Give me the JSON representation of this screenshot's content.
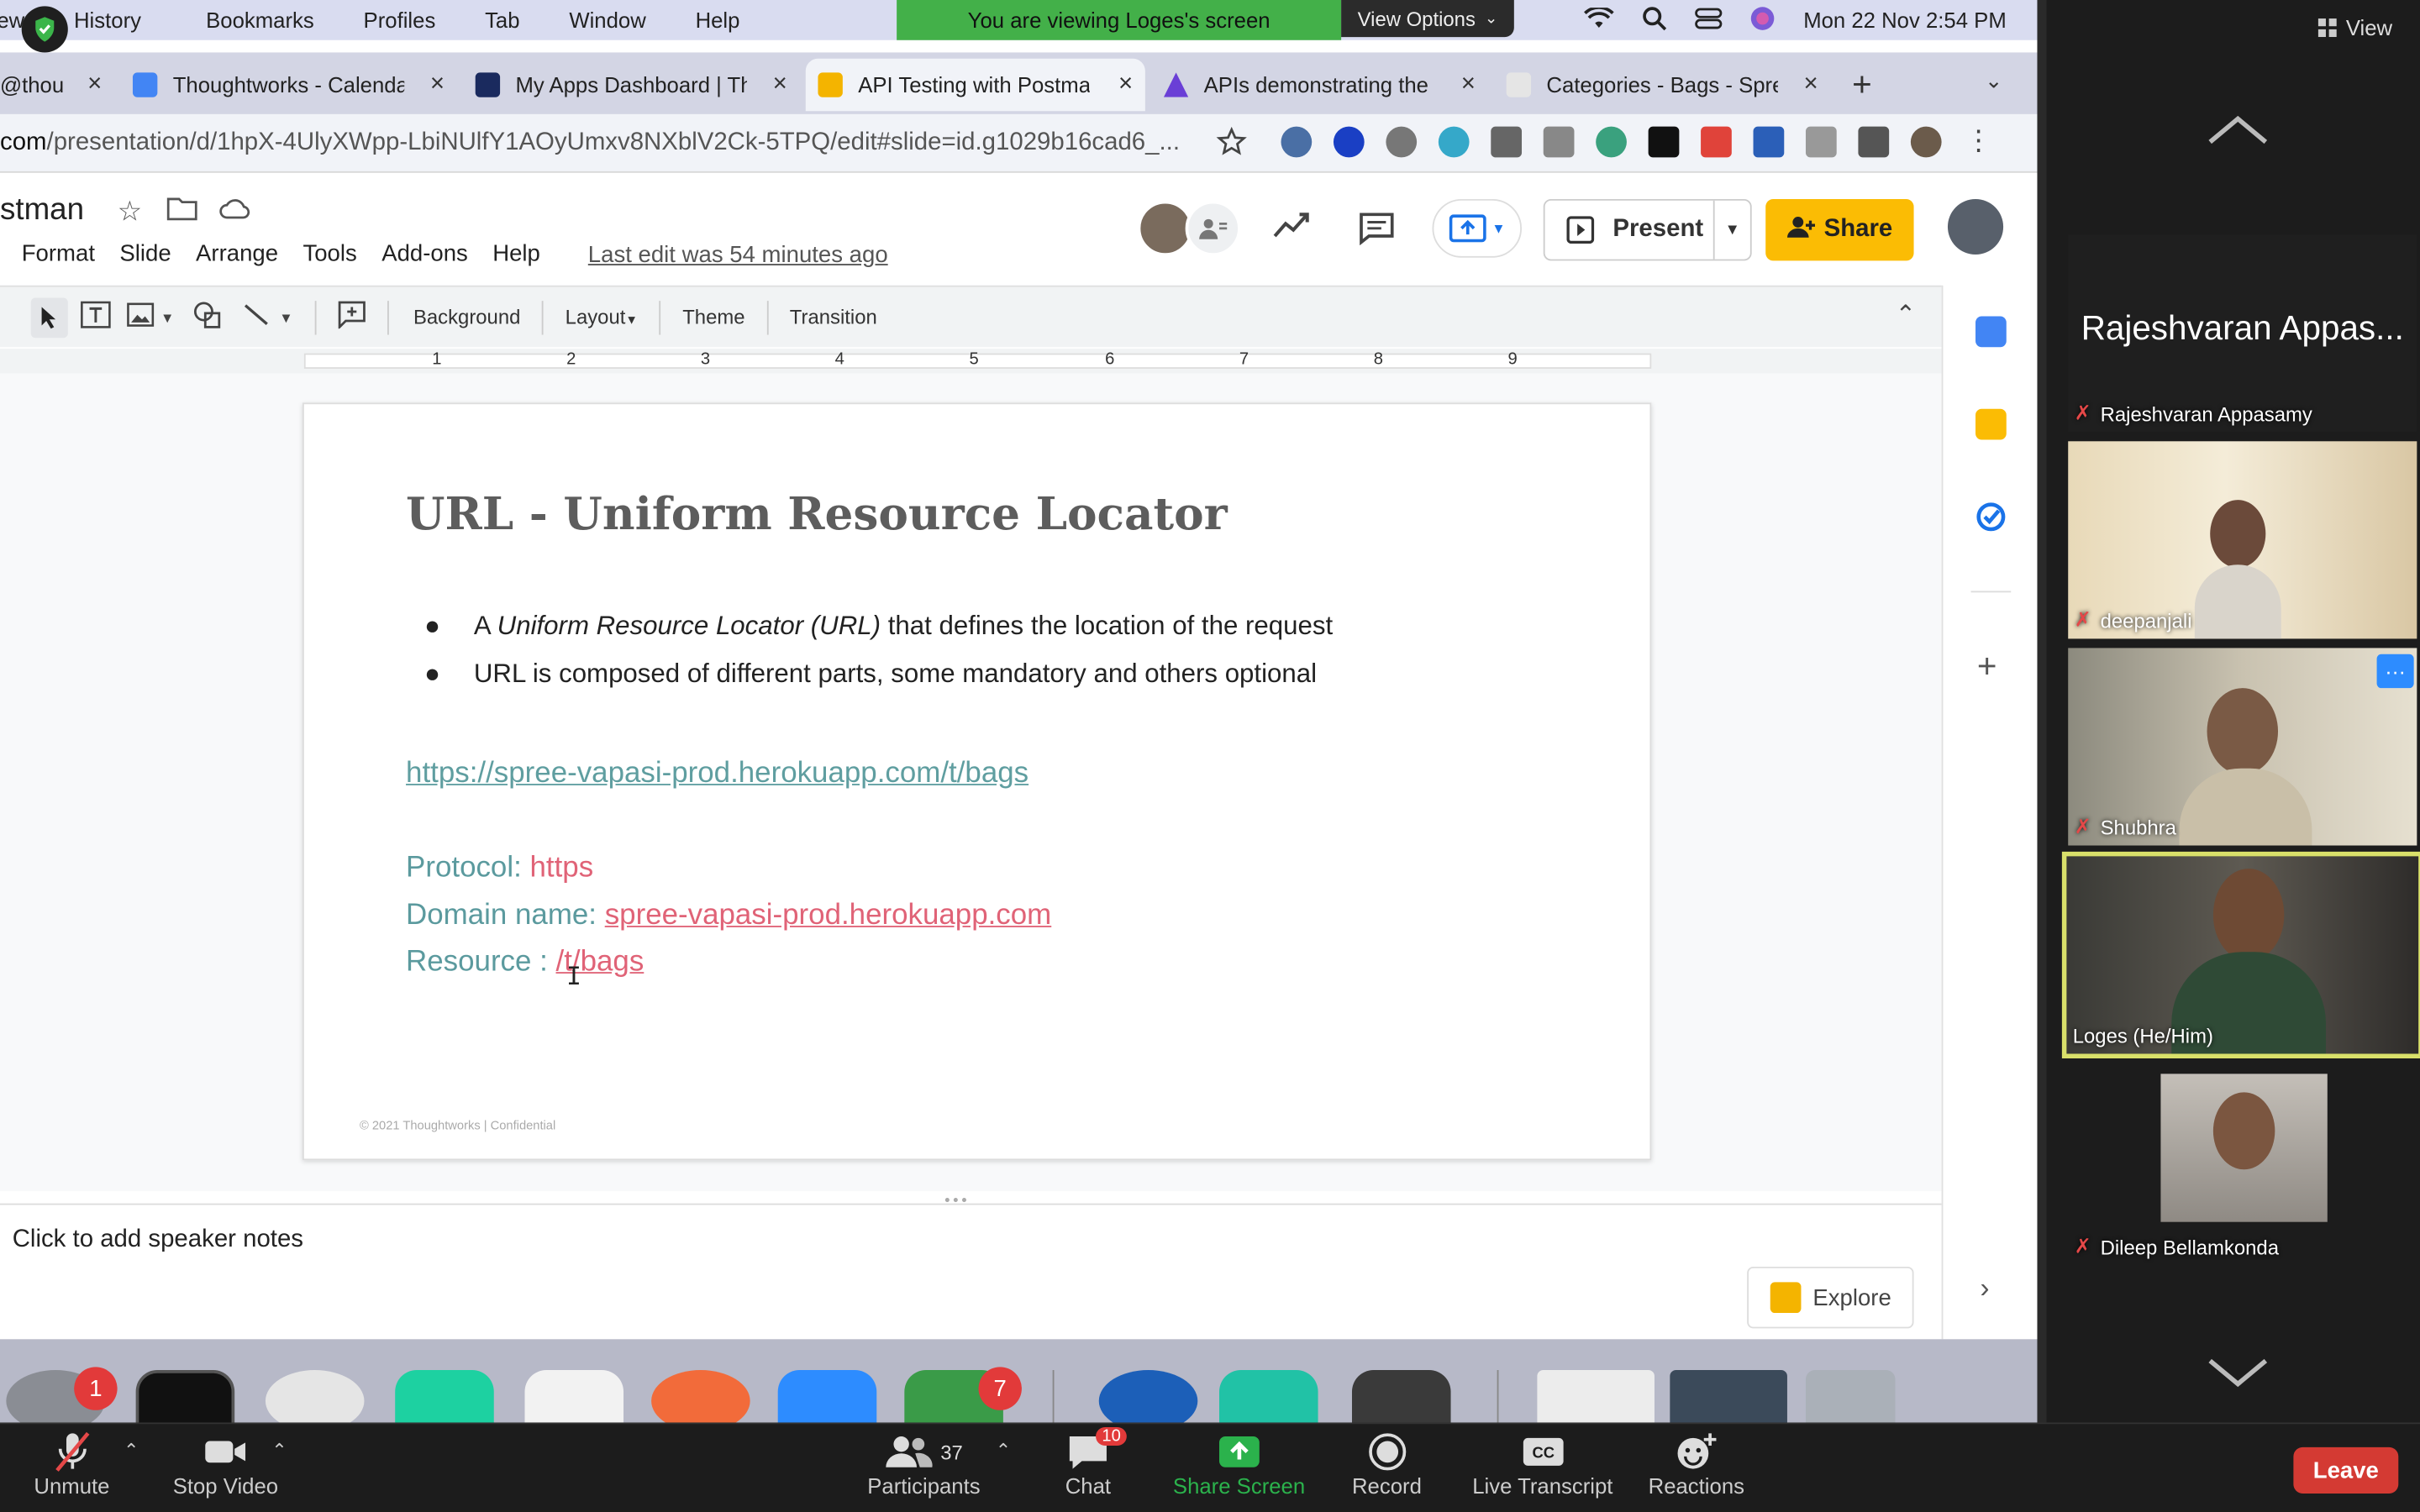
{
  "mac_menubar": {
    "items": [
      "ew",
      "History",
      "Bookmarks",
      "Profiles",
      "Tab",
      "Window",
      "Help"
    ],
    "date_time": "Mon 22 Nov  2:54 PM"
  },
  "zoom_share": {
    "banner": "You are viewing Loges's screen",
    "view_options": "View Options"
  },
  "browser": {
    "tabs": [
      {
        "title": "@thou",
        "active": false
      },
      {
        "title": "Thoughtworks - Calenda",
        "active": false
      },
      {
        "title": "My Apps Dashboard | Th",
        "active": false
      },
      {
        "title": "API Testing with Postma",
        "active": true
      },
      {
        "title": "APIs demonstrating the",
        "active": false
      },
      {
        "title": "Categories - Bags - Spre",
        "active": false
      }
    ],
    "url_host": "com",
    "url_path": "/presentation/d/1hpX-4UlyXWpp-LbiNUlfY1AOyUmxv8NXblV2Ck-5TPQ/edit#slide=id.g1029b16cad6_..."
  },
  "slides_app": {
    "doc_title": "stman",
    "menus": [
      "Format",
      "Slide",
      "Arrange",
      "Tools",
      "Add-ons",
      "Help"
    ],
    "last_edit": "Last edit was 54 minutes ago",
    "present_label": "Present",
    "share_label": "Share",
    "toolbar": {
      "background": "Background",
      "layout": "Layout",
      "theme": "Theme",
      "transition": "Transition"
    },
    "ruler_marks": [
      "1",
      "2",
      "3",
      "4",
      "5",
      "6",
      "7",
      "8",
      "9"
    ],
    "speaker_notes": "Click to add speaker notes",
    "explore_label": "Explore"
  },
  "slide": {
    "title": "URL - Uniform Resource Locator",
    "bullet1_pre": "A ",
    "bullet1_italic": "Uniform Resource Locator (URL)",
    "bullet1_post": " that defines the location of the request",
    "bullet2": "URL is composed of different parts, some mandatory and others optional",
    "example_url": "https://spree-vapasi-prod.herokuapp.com/t/bags",
    "protocol_label": "Protocol: ",
    "protocol_value": "https",
    "domain_label": "Domain name: ",
    "domain_value": "spree-vapasi-prod.herokuapp.com",
    "resource_label": "Resource : ",
    "resource_value": "/t/bags",
    "footer": "© 2021 Thoughtworks  |  Confidential"
  },
  "zoom_gallery": {
    "view_label": "View",
    "participants": [
      {
        "name": "Rajeshvaran Appasamy",
        "big_name": "Rajeshvaran Appas...",
        "video": false,
        "muted": true
      },
      {
        "name": "deepanjali",
        "video": true,
        "muted": true
      },
      {
        "name": "Shubhra",
        "video": true,
        "muted": true
      },
      {
        "name": "Loges  (He/Him)",
        "video": true,
        "muted": false,
        "active_speaker": true
      },
      {
        "name": "Dileep Bellamkonda",
        "video": true,
        "muted": true
      }
    ]
  },
  "dock": {
    "badges": {
      "settings": "1",
      "teams": "7"
    }
  },
  "zoom_controls": {
    "unmute": "Unmute",
    "stop_video": "Stop Video",
    "participants": "Participants",
    "participants_count": "37",
    "chat": "Chat",
    "chat_badge": "10",
    "share_screen": "Share Screen",
    "record": "Record",
    "live_transcript": "Live Transcript",
    "reactions": "Reactions",
    "leave": "Leave"
  },
  "colors": {
    "share_banner": "#43b049",
    "share_button": "#fbbc04",
    "slide_link": "#5f9ea0",
    "slide_value": "#e06377",
    "active_speaker_border": "#d9e06a",
    "leave_button": "#d43a33",
    "share_screen_icon": "#2bb24c"
  }
}
